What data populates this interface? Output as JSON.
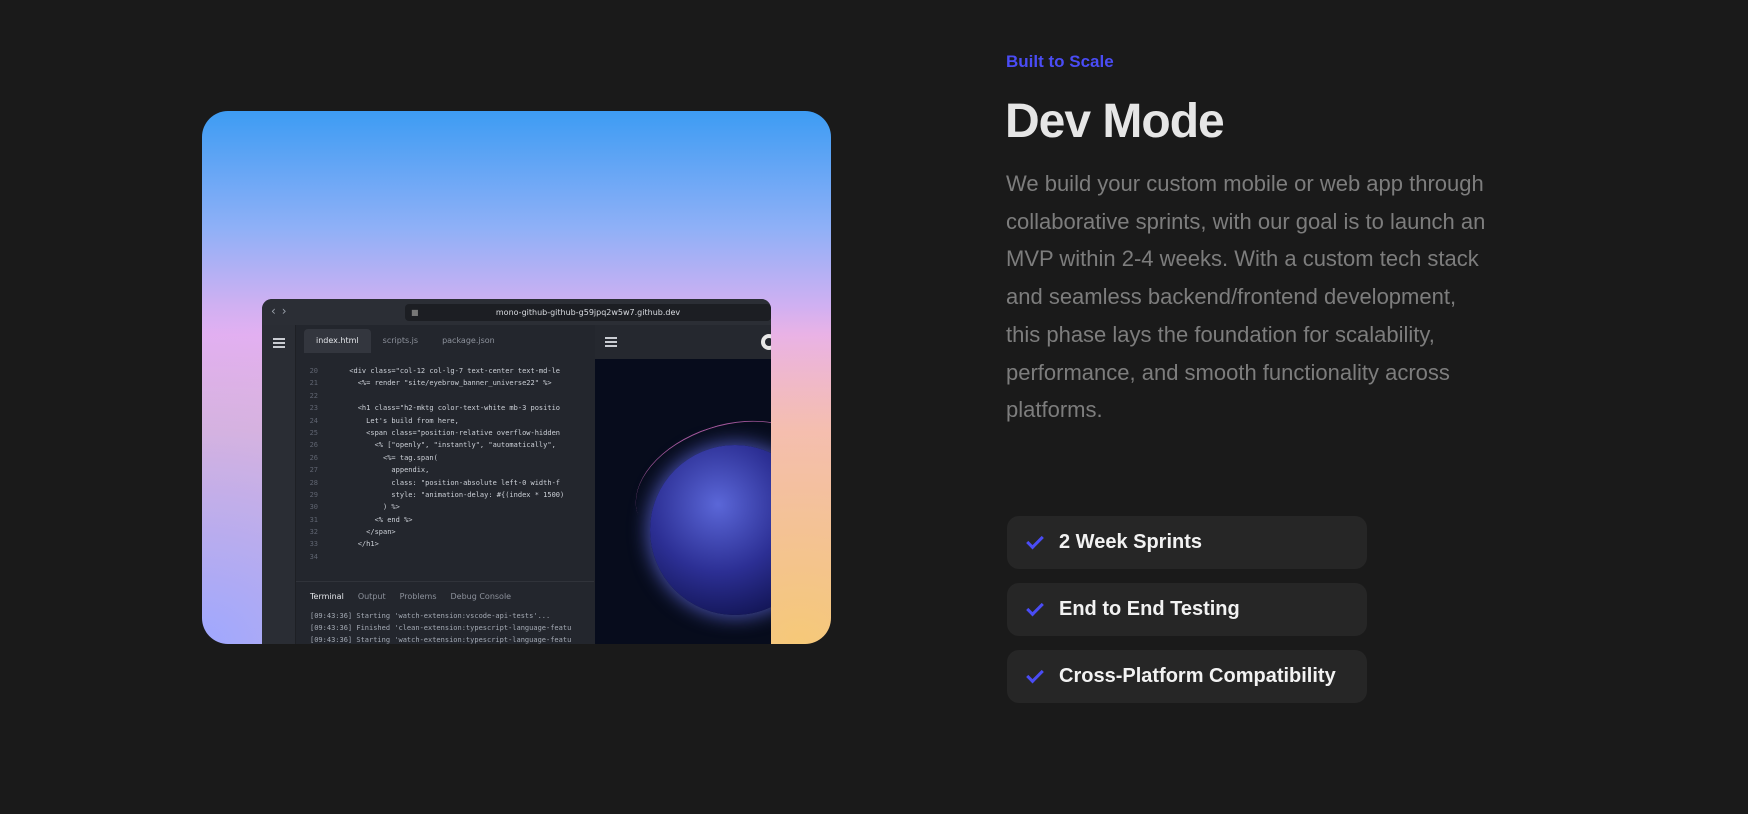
{
  "hero": {
    "ide": {
      "url": "mono-github-github-g59jpq2w5w7.github.dev",
      "tabs": [
        "index.html",
        "scripts.js",
        "package.json"
      ],
      "code_lines": [
        {
          "n": "20",
          "t": "      <div class=\"col-12 col-lg-7 text-center text-md-le"
        },
        {
          "n": "21",
          "t": "        <%= render \"site/eyebrow_banner_universe22\" %>"
        },
        {
          "n": "22",
          "t": ""
        },
        {
          "n": "23",
          "t": "        <h1 class=\"h2-mktg color-text-white mb-3 positio"
        },
        {
          "n": "24",
          "t": "          Let's build from here,"
        },
        {
          "n": "25",
          "t": "          <span class=\"position-relative overflow-hidden"
        },
        {
          "n": "26",
          "t": "            <% [\"openly\", \"instantly\", \"automatically\","
        },
        {
          "n": "26",
          "t": "              <%= tag.span("
        },
        {
          "n": "27",
          "t": "                appendix,"
        },
        {
          "n": "28",
          "t": "                class: \"position-absolute left-0 width-f"
        },
        {
          "n": "29",
          "t": "                style: \"animation-delay: #{(index * 1500)"
        },
        {
          "n": "30",
          "t": "              ) %>"
        },
        {
          "n": "31",
          "t": "            <% end %>"
        },
        {
          "n": "32",
          "t": "          </span>"
        },
        {
          "n": "33",
          "t": "        </h1>"
        },
        {
          "n": "34",
          "t": ""
        }
      ],
      "terminal_tabs": [
        "Terminal",
        "Output",
        "Problems",
        "Debug Console"
      ],
      "terminal_lines": [
        "[09:43:36] Starting 'watch-extension:vscode-api-tests'...",
        "[09:43:36] Finished 'clean-extension:typescript-language-featu",
        "[09:43:36] Starting 'watch-extension:typescript-language-featu"
      ]
    }
  },
  "content": {
    "eyebrow": "Built to Scale",
    "title": "Dev Mode",
    "description": "We build your custom mobile or web app through collaborative sprints, with our goal is to launch an MVP within 2-4 weeks. With a custom tech stack and seamless backend/frontend development, this phase lays the foundation for scalability, performance, and smooth functionality across platforms.",
    "features": [
      {
        "label": "2 Week Sprints",
        "icon": "check-icon"
      },
      {
        "label": "End to End Testing",
        "icon": "check-icon"
      },
      {
        "label": "Cross-Platform Compatibility",
        "icon": "check-icon"
      }
    ]
  },
  "colors": {
    "background": "#1a1a1a",
    "accent": "#4a4cf5",
    "feature_bg": "#262626",
    "text_muted": "#7d7d7d"
  }
}
